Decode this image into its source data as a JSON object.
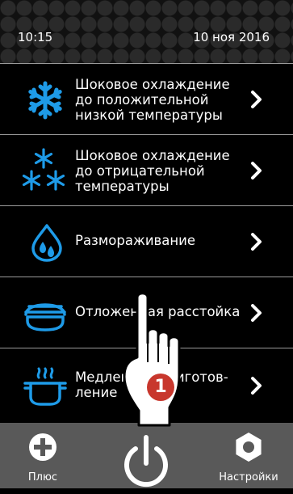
{
  "status": {
    "time": "10:15",
    "date": "10 ноя 2016"
  },
  "menu": {
    "items": [
      {
        "label": "Шоковое охлаждение до положительной низкой температуры",
        "icon": "snowflake-icon"
      },
      {
        "label": "Шоковое охлаждение до отрицательной температуры",
        "icon": "triple-snowflake-icon"
      },
      {
        "label": "Размораживание",
        "icon": "water-drops-icon"
      },
      {
        "label": "Отложенная расстойка",
        "icon": "proofing-dome-icon"
      },
      {
        "label": "Медленное приготов-ление",
        "icon": "cooking-pot-icon"
      }
    ]
  },
  "bottom_bar": {
    "plus_label": "Плюс",
    "settings_label": "Настройки"
  },
  "overlay": {
    "step_number": "1"
  },
  "colors": {
    "accent": "#1e9be8",
    "divider": "#9a9a9a",
    "bottom_bar": "#595959",
    "badge": "#c8372d"
  }
}
